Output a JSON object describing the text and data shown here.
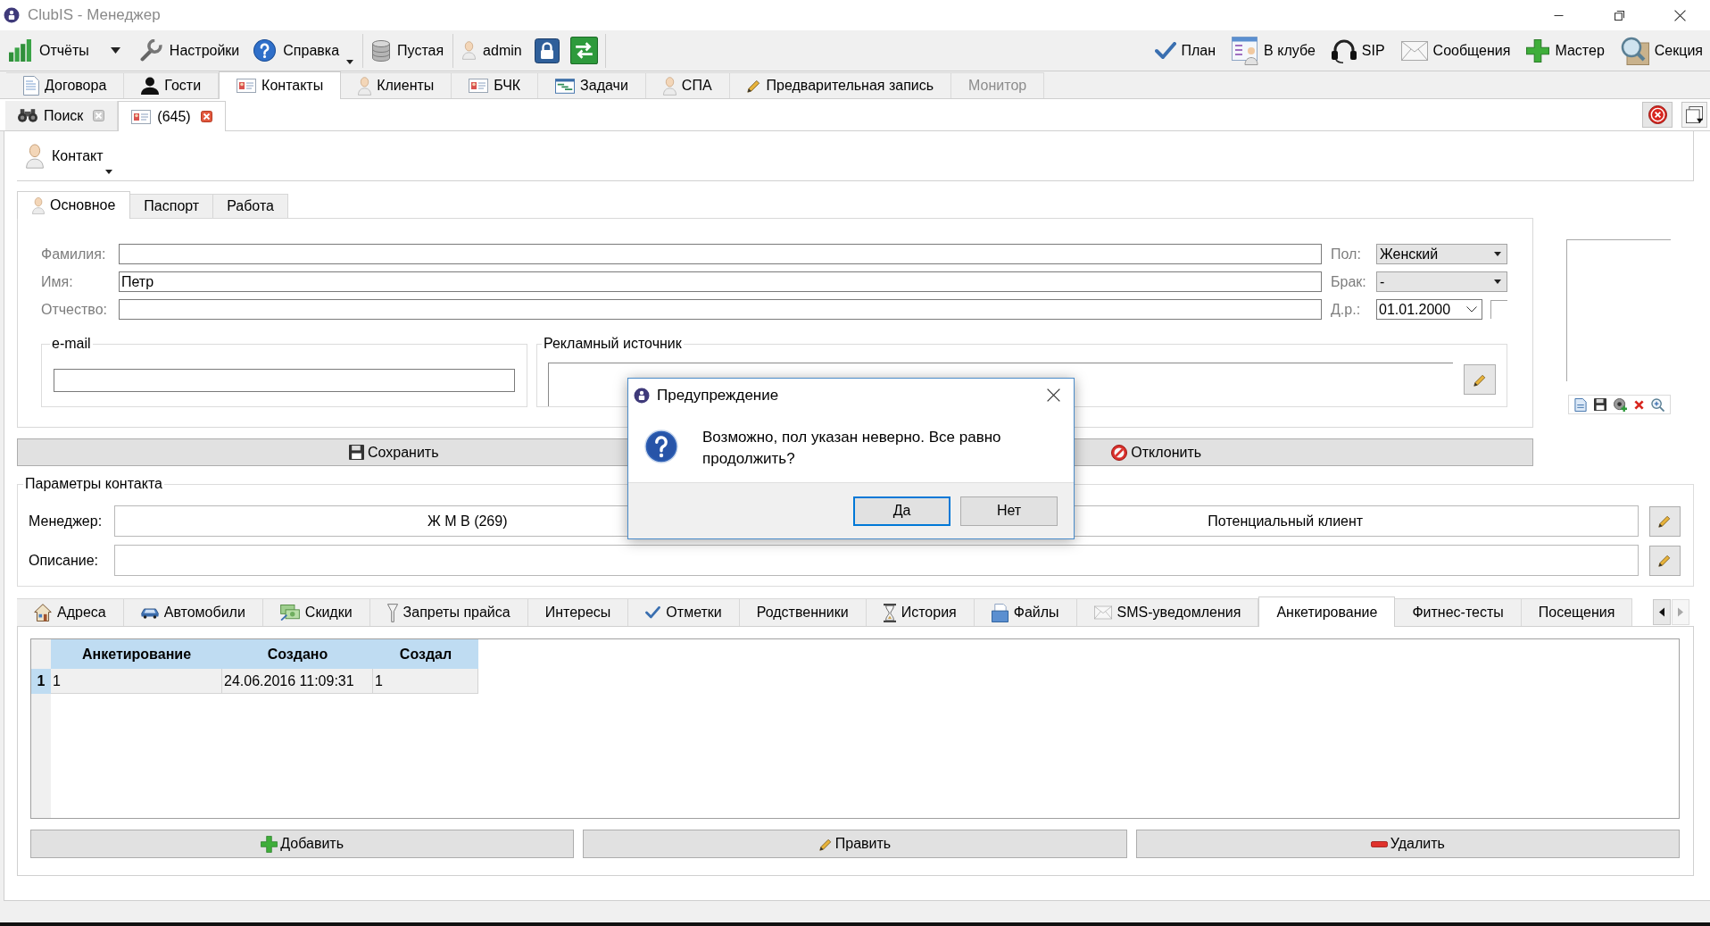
{
  "window": {
    "title": "ClubIS - Менеджер"
  },
  "toolbar": {
    "groups": [
      [
        {
          "kind": "split",
          "label": "Отчёты"
        },
        {
          "kind": "button",
          "label": "Настройки"
        },
        {
          "kind": "menu",
          "label": "Справка"
        }
      ],
      [
        {
          "kind": "button",
          "label": "Пустая"
        }
      ],
      [
        {
          "kind": "button",
          "label": "admin"
        },
        {
          "kind": "icon"
        },
        {
          "kind": "icon"
        }
      ]
    ],
    "right": [
      {
        "label": "План"
      },
      {
        "label": "В клубе"
      },
      {
        "label": "SIP"
      },
      {
        "label": "Сообщения"
      },
      {
        "label": "Мастер"
      },
      {
        "label": "Секция"
      }
    ]
  },
  "main_tabs": [
    {
      "label": "Договора",
      "selected": false,
      "disabled": false
    },
    {
      "label": "Гости",
      "selected": false,
      "disabled": false
    },
    {
      "label": "Контакты",
      "selected": true,
      "disabled": false
    },
    {
      "label": "Клиенты",
      "selected": false,
      "disabled": false
    },
    {
      "label": "БЧК",
      "selected": false,
      "disabled": false
    },
    {
      "label": "Задачи",
      "selected": false,
      "disabled": false
    },
    {
      "label": "СПА",
      "selected": false,
      "disabled": false
    },
    {
      "label": "Предварительная запись",
      "selected": false,
      "disabled": false
    },
    {
      "label": "Монитор",
      "selected": false,
      "disabled": true
    }
  ],
  "document_tabs": [
    {
      "label": "Поиск",
      "selected": false
    },
    {
      "label": "(645)",
      "selected": true
    }
  ],
  "contact": {
    "label": "Контакт",
    "tabs": [
      {
        "label": "Основное",
        "selected": true
      },
      {
        "label": "Паспорт",
        "selected": false
      },
      {
        "label": "Работа",
        "selected": false
      }
    ],
    "name_fields": [
      {
        "label": "Фамилия:"
      },
      {
        "label": "Имя:",
        "value": "Петр"
      },
      {
        "label": "Отчество:"
      }
    ],
    "side_fields": [
      {
        "kind": "select",
        "label": "Пол:",
        "value": "Женский"
      },
      {
        "kind": "select",
        "label": "Брак:",
        "value": "-"
      },
      {
        "kind": "date",
        "label": "Д.р.:",
        "value": "01.01.2000"
      }
    ],
    "email": {
      "title": "e-mail"
    },
    "ad_source": {
      "title": "Рекламный источник"
    },
    "buttons": [
      {
        "label": "Сохранить"
      },
      {
        "label": "Отклонить"
      }
    ]
  },
  "parameters": {
    "title": "Параметры контакта",
    "rows": [
      {
        "label": "Менеджер:",
        "values": [
          "Ж М В (269)",
          "Потенциальный клиент"
        ]
      },
      {
        "label": "Описание:"
      }
    ]
  },
  "detail_tabs": [
    {
      "label": "Адреса",
      "selected": false
    },
    {
      "label": "Автомобили",
      "selected": false
    },
    {
      "label": "Скидки",
      "selected": false
    },
    {
      "label": "Запреты прайса",
      "selected": false
    },
    {
      "label": "Интересы",
      "selected": false
    },
    {
      "label": "Отметки",
      "selected": false
    },
    {
      "label": "Родственники",
      "selected": false
    },
    {
      "label": "История",
      "selected": false
    },
    {
      "label": "Файлы",
      "selected": false
    },
    {
      "label": "SMS-уведомления",
      "selected": false
    },
    {
      "label": "Анкетирование",
      "selected": true
    },
    {
      "label": "Фитнес-тесты",
      "selected": false
    },
    {
      "label": "Посещения",
      "selected": false
    }
  ],
  "tab_scroll": [
    {
      "kind": "left",
      "disabled": false
    },
    {
      "kind": "right",
      "disabled": true
    }
  ],
  "table": {
    "columns": [
      "Анкетирование",
      "Создано",
      "Создал"
    ],
    "rows": [
      {
        "number": "1",
        "selected": true,
        "cells": [
          "1",
          "24.06.2016 11:09:31",
          "1"
        ]
      }
    ]
  },
  "table_buttons": [
    {
      "label": "Добавить"
    },
    {
      "label": "Править"
    },
    {
      "label": "Удалить"
    }
  ],
  "dialog": {
    "title": "Предупреждение",
    "message": "Возможно, пол указан неверно. Все равно продолжить?",
    "buttons": [
      {
        "label": "Да",
        "selected": true
      },
      {
        "label": "Нет",
        "selected": false
      }
    ]
  }
}
